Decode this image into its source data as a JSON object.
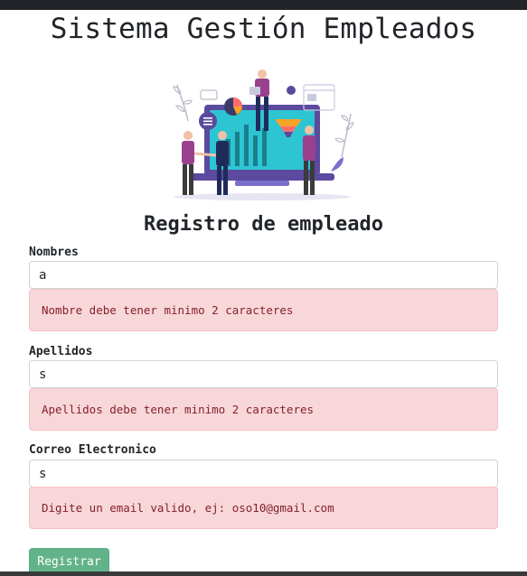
{
  "page": {
    "title": "Sistema Gestión Empleados",
    "subtitle": "Registro de empleado"
  },
  "form": {
    "fields": [
      {
        "label": "Nombres",
        "value": "a",
        "error": "Nombre debe tener minimo 2 caracteres"
      },
      {
        "label": "Apellidos",
        "value": "s",
        "error": "Apellidos debe tener minimo 2 caracteres"
      },
      {
        "label": "Correo Electronico",
        "value": "s",
        "error": "Digite un email valido, ej: oso10@gmail.com"
      }
    ],
    "submit_label": "Registrar"
  },
  "colors": {
    "alert_bg": "#f8d7da",
    "alert_text": "#842029",
    "button_bg": "#63b38a",
    "illustration_purple": "#5b4a9e",
    "illustration_teal": "#2ec5d3"
  },
  "illustration": {
    "name": "business-team-dashboard-illustration"
  }
}
